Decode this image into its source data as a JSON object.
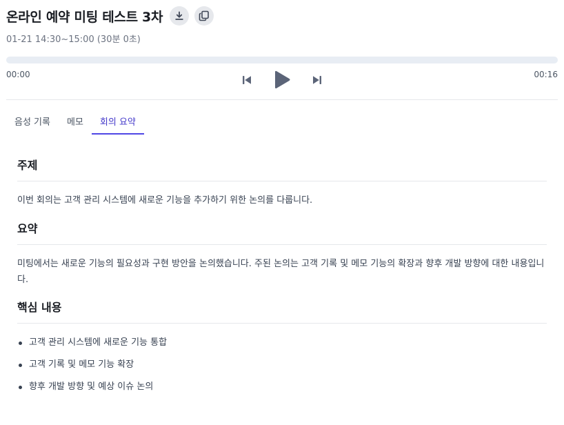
{
  "meeting": {
    "title": "온라인 예약 미팅 테스트 3차",
    "datetime": "01-21 14:30~15:00 (30분 0초)"
  },
  "player": {
    "current_time": "00:00",
    "total_time": "00:16",
    "progress": 0
  },
  "tabs": [
    {
      "label": "음성 기록",
      "active": false
    },
    {
      "label": "메모",
      "active": false
    },
    {
      "label": "회의 요약",
      "active": true
    }
  ],
  "summary": {
    "topic": {
      "heading": "주제",
      "text": "이번 회의는 고객 관리 시스템에 새로운 기능을 추가하기 위한 논의를 다룹니다."
    },
    "overview": {
      "heading": "요약",
      "text": "미팅에서는 새로운 기능의 필요성과 구현 방안을 논의했습니다. 주된 논의는 고객 기록 및 메모 기능의 확장과 향후 개발 방향에 대한 내용입니다."
    },
    "key_points": {
      "heading": "핵심 내용",
      "items": [
        "고객 관리 시스템에 새로운 기능 통합",
        "고객 기록 및 메모 기능 확장",
        "향후 개발 방향 및 예상 이슈 논의"
      ]
    }
  },
  "icons": {
    "download": "download-icon",
    "copy": "copy-icon",
    "previous": "skip-previous-icon",
    "play": "play-icon",
    "next": "skip-next-icon"
  },
  "colors": {
    "accent": "#4f46e5",
    "icon": "#5b6478"
  }
}
